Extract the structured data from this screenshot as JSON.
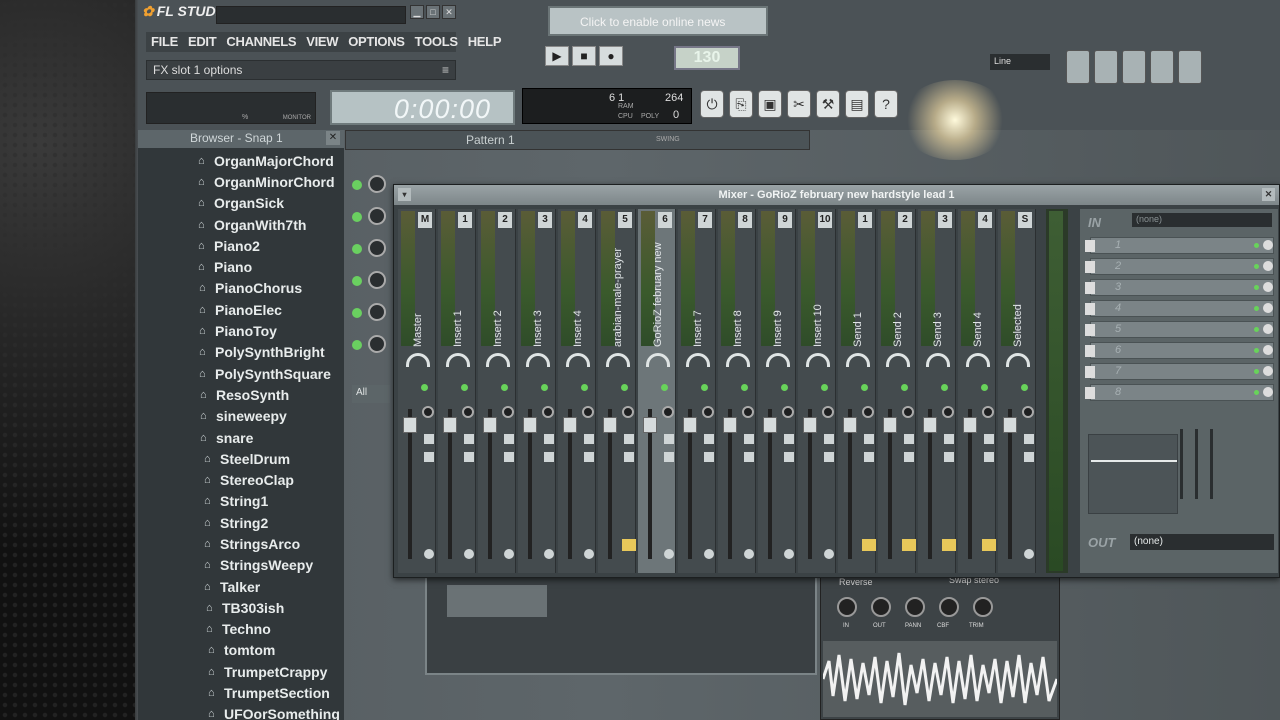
{
  "app": {
    "name": "FL STUDIO",
    "menu": [
      "FILE",
      "EDIT",
      "CHANNELS",
      "VIEW",
      "OPTIONS",
      "TOOLS",
      "HELP"
    ],
    "fx_slot_label": "FX slot 1 options",
    "hint_text": "Click to enable online news",
    "tempo": "130",
    "time": "0:00:00",
    "monitor_label": "MONITOR",
    "monitor_pct": "%",
    "cpu": {
      "a": "6 1",
      "b": "264",
      "l1": "RAM",
      "l2": "CPU",
      "l3": "POLY",
      "z": "0"
    },
    "snap_value": "Line"
  },
  "browser": {
    "title": "Browser - Snap 1",
    "items": [
      "OrganMajorChord",
      "OrganMinorChord",
      "OrganSick",
      "OrganWith7th",
      "Piano2",
      "Piano",
      "PianoChorus",
      "PianoElec",
      "PianoToy",
      "PolySynthBright",
      "PolySynthSquare",
      "ResoSynth",
      "sineweepy",
      "snare",
      "SteelDrum",
      "StereoClap",
      "String1",
      "String2",
      "StringsArco",
      "StringsWeepy",
      "Talker",
      "TB303ish",
      "Techno",
      "tomtom",
      "TrumpetCrappy",
      "TrumpetSection",
      "UFOorSomething"
    ]
  },
  "pattern": {
    "name": "Pattern 1",
    "swing": "SWING",
    "all_label": "All"
  },
  "plugin": {
    "reverse": "Reverse",
    "swap": "Swap stereo",
    "knobs": [
      "IN",
      "OUT",
      "PANN",
      "CBF",
      "TRIM"
    ]
  },
  "mixer": {
    "title": "Mixer - GoRioZ february new hardstyle lead 1",
    "in_label": "IN",
    "in_value": "(none)",
    "out_label": "OUT",
    "out_value": "(none)",
    "slots": [
      "1",
      "2",
      "3",
      "4",
      "5",
      "6",
      "7",
      "8"
    ],
    "strips": [
      {
        "num": "M",
        "name": "Master"
      },
      {
        "num": "1",
        "name": "Insert 1"
      },
      {
        "num": "2",
        "name": "Insert 2"
      },
      {
        "num": "3",
        "name": "Insert 3"
      },
      {
        "num": "4",
        "name": "Insert 4"
      },
      {
        "num": "5",
        "name": "arabian-male-prayer"
      },
      {
        "num": "6",
        "name": "GoRioZ february new"
      },
      {
        "num": "7",
        "name": "Insert 7"
      },
      {
        "num": "8",
        "name": "Insert 8"
      },
      {
        "num": "9",
        "name": "Insert 9"
      },
      {
        "num": "10",
        "name": "Insert 10"
      },
      {
        "num": "1",
        "name": "Send 1"
      },
      {
        "num": "2",
        "name": "Send 2"
      },
      {
        "num": "3",
        "name": "Send 3"
      },
      {
        "num": "4",
        "name": "Send 4"
      },
      {
        "num": "S",
        "name": "Selected"
      }
    ]
  }
}
